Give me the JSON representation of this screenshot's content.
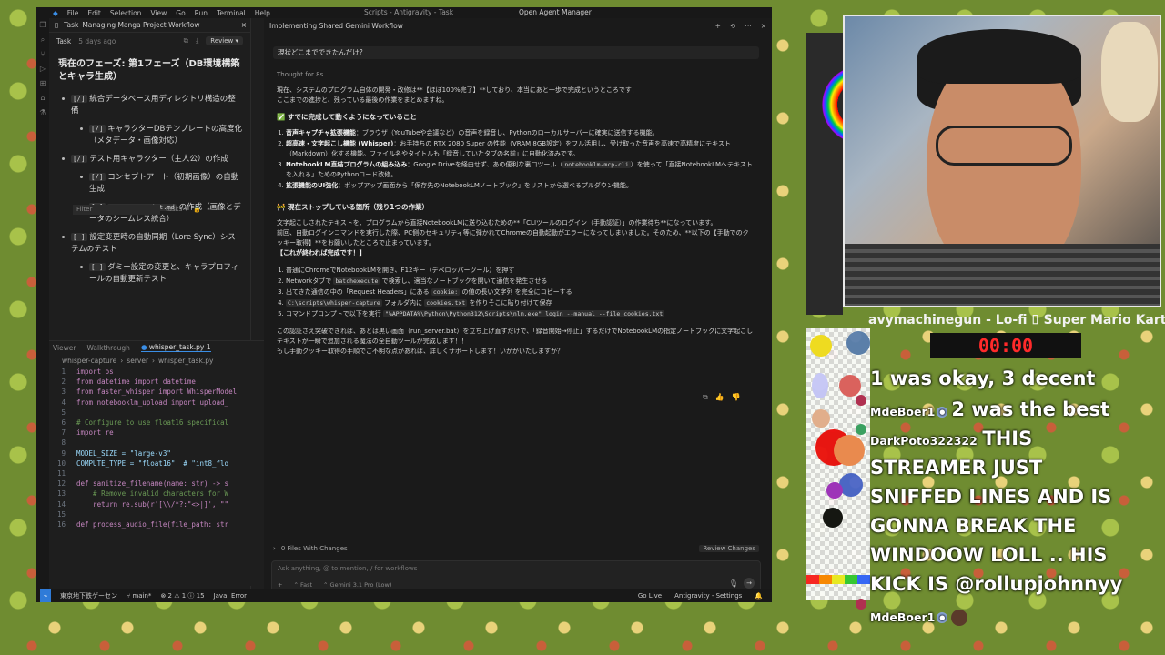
{
  "ide": {
    "menu": [
      "File",
      "Edit",
      "Selection",
      "View",
      "Go",
      "Run",
      "Terminal",
      "Help"
    ],
    "window_title": "Scripts - Antigravity - Task",
    "agent_manager": "Open Agent Manager",
    "left_tab": "Task",
    "left_tab_title": "Managing Manga Project Workflow",
    "task_label": "Task",
    "task_age": "5 days ago",
    "review_label": "Review",
    "phase_title": "現在のフェーズ: 第1フェーズ（DB環境構築とキャラ生成）",
    "tasks": [
      {
        "level": 0,
        "check": "[/]",
        "text": "統合データベース用ディレクトリ構造の整備"
      },
      {
        "level": 1,
        "check": "[/]",
        "text": "キャラクターDBテンプレートの高度化（メタデータ・画像対応）"
      },
      {
        "level": 0,
        "check": "[/]",
        "text": "テスト用キャラクター（主人公）の作成"
      },
      {
        "level": 1,
        "check": "[/]",
        "text": "コンセプトアート（初期画像）の自動生成"
      },
      {
        "level": 1,
        "check": "[ ]",
        "code": "01_protagonist.md",
        "text": "の作成（画像とデータのシームレス統合）"
      },
      {
        "level": 0,
        "check": "[ ]",
        "text": "設定変更時の自動同期（Lore Sync）システムのテスト"
      },
      {
        "level": 1,
        "check": "[ ]",
        "text": "ダミー設定の変更と、キャラプロフィールの自動更新テスト"
      }
    ],
    "panel_tabs": [
      "Viewer",
      "Walkthrough",
      "whisper_task.py"
    ],
    "panel_tab_mod": "1",
    "breadcrumb": [
      "whisper-capture",
      "server",
      "whisper_task.py"
    ],
    "code_lines": [
      {
        "n": "1",
        "t": "import os"
      },
      {
        "n": "2",
        "t": "from datetime import datetime"
      },
      {
        "n": "3",
        "t": "from faster_whisper import WhisperModel"
      },
      {
        "n": "4",
        "t": "from notebooklm_upload import upload_"
      },
      {
        "n": "5",
        "t": ""
      },
      {
        "n": "6",
        "t": "# Configure to use float16 specifical"
      },
      {
        "n": "7",
        "t": "import re"
      },
      {
        "n": "8",
        "t": ""
      },
      {
        "n": "9",
        "t": "MODEL_SIZE = \"large-v3\""
      },
      {
        "n": "10",
        "t": "COMPUTE_TYPE = \"float16\"  # \"int8_flo"
      },
      {
        "n": "11",
        "t": ""
      },
      {
        "n": "12",
        "t": "def sanitize_filename(name: str) -> s"
      },
      {
        "n": "13",
        "t": "    # Remove invalid characters for W"
      },
      {
        "n": "14",
        "t": "    return re.sub(r'[\\\\/*?:\"<>|]', \"\""
      },
      {
        "n": "15",
        "t": ""
      },
      {
        "n": "16",
        "t": "def process_audio_file(file_path: str"
      }
    ],
    "filter_placeholder": "Filter",
    "filter_select": "tasks",
    "chat_title": "Implementing Shared Gemini Workflow",
    "user_question": "現状どこまでできたんだけ？",
    "thought": "Thought for 8s",
    "intro1": "現在、システムのプログラム自体の開発・改修は**【ほぼ100%完了】**しており、本当にあと一歩で完成というところです！",
    "intro2": "ここまでの進捗と、残っている最後の作業をまとめますね。",
    "done_heading": "✅ すでに完成して動くようになっていること",
    "done_items": [
      {
        "b": "音声キャプチャ拡張機能",
        "t": "：ブラウザ（YouTubeや会議など）の音声を録音し、Pythonのローカルサーバーに確実に送信する機能。"
      },
      {
        "b": "超高速・文字起こし機能 (Whisper)",
        "t": "：お手持ちの RTX 2080 Super の性能（VRAM 8GB設定）をフル活用し、受け取った音声を高速で高精度にテキスト（Markdown）化する機能。ファイル名やタイトルも「録音していたタブの名前」に自動化済みです。"
      },
      {
        "b": "NotebookLM直結プログラムの組み込み",
        "t": "：Google Driveを経由せず、あの便利な裏口ツール（",
        "code": "notebooklm-mcp-cli",
        "t2": "）を使って「直接NotebookLMへテキストを入れる」ためのPythonコード改修。"
      },
      {
        "b": "拡張機能のUI強化",
        "t": "：ポップアップ画面から「保存先のNotebookLMノートブック」をリストから選べるプルダウン機能。"
      }
    ],
    "stop_heading": "🚧 現在ストップしている箇所（残り1つの作業）",
    "stop_p1": "文字起こしされたテキストを、プログラムから直接NotebookLMに送り込むための**「CLIツールのログイン（手動認証）」の作業待ち**になっています。",
    "stop_p2": "前回、自動ログインコマンドを実行した際、PC側のセキュリティ等に弾かれてChromeの自動起動がエラーになってしまいました。そのため、**以下の【手動でのクッキー取得】**をお願いしたところで止まっています。",
    "stop_p3": "【これが終われば完成です！】",
    "steps": [
      {
        "t": "普通にChromeでNotebookLMを開き、F12キー（デベロッパーツール）を押す"
      },
      {
        "t": "Networkタブで ",
        "code": "batchexecute",
        "t2": " で検索し、適当なノートブックを開いて通信を発生させる"
      },
      {
        "t": "出てきた通信の中の「Request Headers」にある ",
        "code": "cookie:",
        "t2": " の値の長い文字列 を完全にコピーする"
      },
      {
        "t": "",
        "code": "C:\\scripts\\whisper-capture",
        "t2": " フォルダ内に ",
        "code2": "cookies.txt",
        "t3": " を作りそこに貼り付けて保存"
      },
      {
        "t": "コマンドプロンプトで以下を実行 ",
        "code": "\"%APPDATA%\\Python\\Python312\\Scripts\\nlm.exe\" login --manual --file cookies.txt",
        "t2": ""
      }
    ],
    "closing1": "この認証さえ突破できれば、あとは黒い画面（run_server.bat）を立ち上げ直すだけで、「録音開始→停止」するだけでNotebookLMの指定ノートブックに文字起こしテキストが一瞬で追加される魔法の全自動ツールが完成します！！",
    "closing2": "もし手動クッキー取得の手順でご不明な点があれば、詳しくサポートします！いかがいたしますか？",
    "files_changed": "0 Files With Changes",
    "review_changes": "Review Changes",
    "input_placeholder": "Ask anything, @ to mention, / for workflows",
    "input_add": "+",
    "input_mode": "Fast",
    "input_model": "Gemini 3.1 Pro (Low)",
    "status": {
      "branch": "東京地下鉄ゲーセン",
      "git": "main*",
      "errors": "2",
      "warnings": "1",
      "info": "15",
      "java": "Java: Error",
      "golive": "Go Live",
      "settings": "Antigravity - Settings"
    }
  },
  "stream": {
    "now_playing": "avymachinegun - Lo-fi ⌷ Super Mario Kart",
    "timer": "00:00",
    "chat": [
      {
        "type": "msg",
        "text": "1 was okay, 3 decent"
      },
      {
        "type": "user",
        "user": "MdeBoer1",
        "text": "2 was the best"
      },
      {
        "type": "user",
        "user": "DarkPoto322322",
        "text": "THIS"
      },
      {
        "type": "msg",
        "text": "STREAMER JUST"
      },
      {
        "type": "msg",
        "text": "SNIFFED LINES AND IS"
      },
      {
        "type": "msg",
        "text": "GONNA BREAK THE"
      },
      {
        "type": "msg",
        "text": "WINDOOW LOLL .. HIS"
      },
      {
        "type": "msg",
        "text": "KICK IS @rollupjohnnyy"
      },
      {
        "type": "user",
        "user": "MdeBoer1",
        "text": ""
      }
    ]
  }
}
